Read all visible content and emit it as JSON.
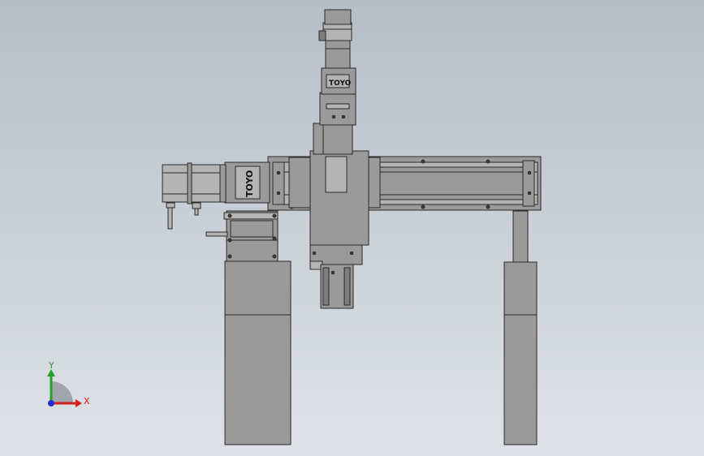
{
  "colors": {
    "background_top": "#b5bdc6",
    "background_bottom": "#dfe3e7",
    "part_fill": "#9a9a9a",
    "outline": "#2a2a2a",
    "axis_x": "#d42020",
    "axis_y": "#2aa02a",
    "axis_z": "#2030d0"
  },
  "branding": {
    "logo_text": "TOYO"
  },
  "triad": {
    "x_label": "X",
    "y_label": "Y"
  }
}
